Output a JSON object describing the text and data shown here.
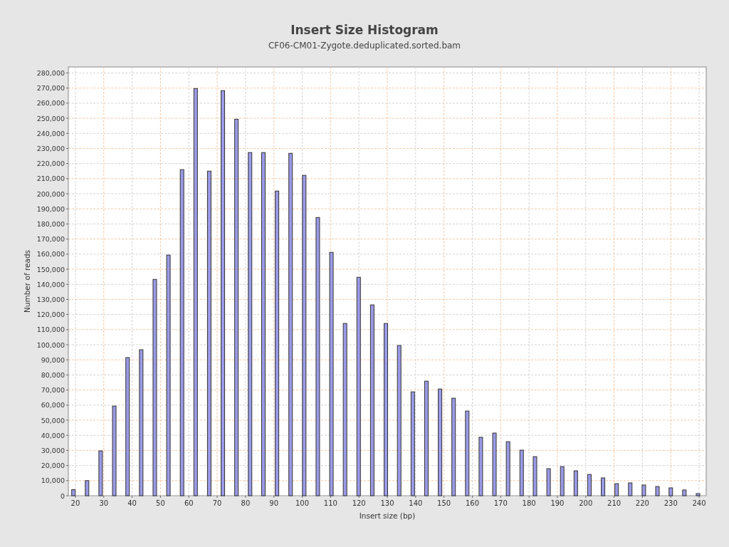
{
  "chart_title": "Insert Size Histogram",
  "subtitle": "CF06-CM01-Zygote.deduplicated.sorted.bam",
  "chart_data": {
    "type": "bar",
    "xlabel": "Insert size (bp)",
    "ylabel": "Number of reads",
    "x": [
      19.3,
      24.1,
      28.9,
      33.7,
      38.4,
      43.2,
      48.0,
      52.8,
      57.6,
      62.4,
      67.2,
      72.0,
      76.8,
      81.6,
      86.3,
      91.1,
      95.9,
      100.7,
      105.5,
      110.3,
      115.1,
      119.9,
      124.7,
      129.5,
      134.2,
      139.0,
      143.8,
      148.6,
      153.4,
      158.2,
      163.0,
      167.8,
      172.6,
      177.4,
      182.1,
      186.9,
      191.7,
      196.5,
      201.3,
      206.1,
      210.9,
      215.7,
      220.5,
      225.3,
      230.0,
      234.8,
      239.6
    ],
    "grid": true,
    "series": [
      {
        "color": "#9a9ae6",
        "values": [
          4000,
          10000,
          29700,
          59400,
          91500,
          96700,
          143300,
          159400,
          216000,
          269700,
          215000,
          268300,
          249400,
          227300,
          227300,
          201800,
          226800,
          212200,
          184300,
          161200,
          114100,
          144700,
          126400,
          114100,
          99500,
          68800,
          75900,
          70700,
          64600,
          56100,
          38700,
          41500,
          35800,
          30200,
          25900,
          17900,
          19300,
          16500,
          14100,
          11800,
          8000,
          8500,
          7100,
          6100,
          5200,
          3800,
          1400
        ]
      }
    ],
    "xlim": [
      17.5,
      242.5
    ],
    "ylim": [
      0,
      284000
    ],
    "xticks": [
      20,
      30,
      40,
      50,
      60,
      70,
      80,
      90,
      100,
      110,
      120,
      130,
      140,
      150,
      160,
      170,
      180,
      190,
      200,
      210,
      220,
      230,
      240
    ],
    "yticks": [
      {
        "value": 0,
        "label": "0"
      },
      {
        "value": 10000,
        "label": "10,000"
      },
      {
        "value": 20000,
        "label": "20,000"
      },
      {
        "value": 30000,
        "label": "30,000"
      },
      {
        "value": 40000,
        "label": "40,000"
      },
      {
        "value": 50000,
        "label": "50,000"
      },
      {
        "value": 60000,
        "label": "60,000"
      },
      {
        "value": 70000,
        "label": "70,000"
      },
      {
        "value": 80000,
        "label": "80,000"
      },
      {
        "value": 90000,
        "label": "90,000"
      },
      {
        "value": 100000,
        "label": "100,000"
      },
      {
        "value": 110000,
        "label": "110,000"
      },
      {
        "value": 120000,
        "label": "120,000"
      },
      {
        "value": 130000,
        "label": "130,000"
      },
      {
        "value": 140000,
        "label": "140,000"
      },
      {
        "value": 150000,
        "label": "150,000"
      },
      {
        "value": 160000,
        "label": "160,000"
      },
      {
        "value": 170000,
        "label": "170,000"
      },
      {
        "value": 180000,
        "label": "180,000"
      },
      {
        "value": 190000,
        "label": "190,000"
      },
      {
        "value": 200000,
        "label": "200,000"
      },
      {
        "value": 210000,
        "label": "210,000"
      },
      {
        "value": 220000,
        "label": "220,000"
      },
      {
        "value": 230000,
        "label": "230,000"
      },
      {
        "value": 240000,
        "label": "240,000"
      },
      {
        "value": 250000,
        "label": "250,000"
      },
      {
        "value": 260000,
        "label": "260,000"
      },
      {
        "value": 270000,
        "label": "270,000"
      },
      {
        "value": 280000,
        "label": "280,000"
      }
    ]
  }
}
